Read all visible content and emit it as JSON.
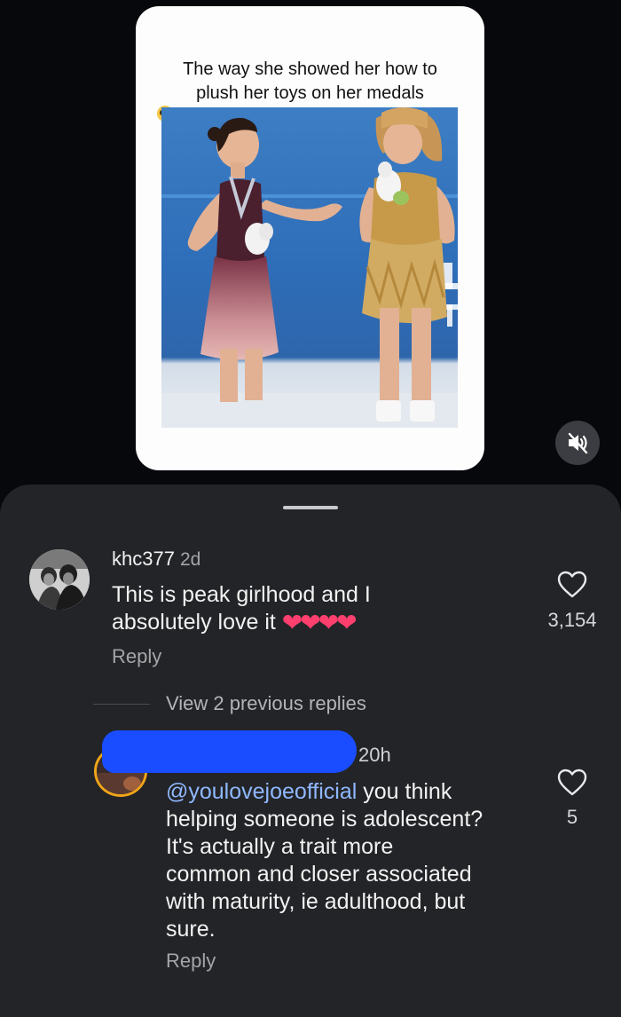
{
  "post": {
    "caption_line1": "The way she showed her how to",
    "caption_line2": "plush her toys on her medals"
  },
  "comments": [
    {
      "username": "khc377",
      "time": "2d",
      "text_line1": "This is peak girlhood and I",
      "text_line2": "absolutely love it",
      "text_emoji": "❤❤❤❤",
      "reply_label": "Reply",
      "like_count": "3,154"
    }
  ],
  "thread": {
    "view_previous_label": "View 2 previous replies"
  },
  "reply": {
    "time": "20h",
    "mention": "@youlovejoeofficial",
    "text_lines": [
      " you think",
      "helping someone is adolescent?",
      "It's actually a trait more",
      "common and closer associated",
      "with maturity, ie adulthood, but",
      "sure."
    ],
    "reply_label": "Reply",
    "like_count": "5"
  },
  "colors": {
    "background": "#07080c",
    "sheet": "#232427",
    "mention": "#8fb8ff",
    "redaction": "#1a4dff",
    "story_ring": "#f0a51a"
  },
  "icons": [
    "volume-muted-icon",
    "heart-outline-icon"
  ]
}
